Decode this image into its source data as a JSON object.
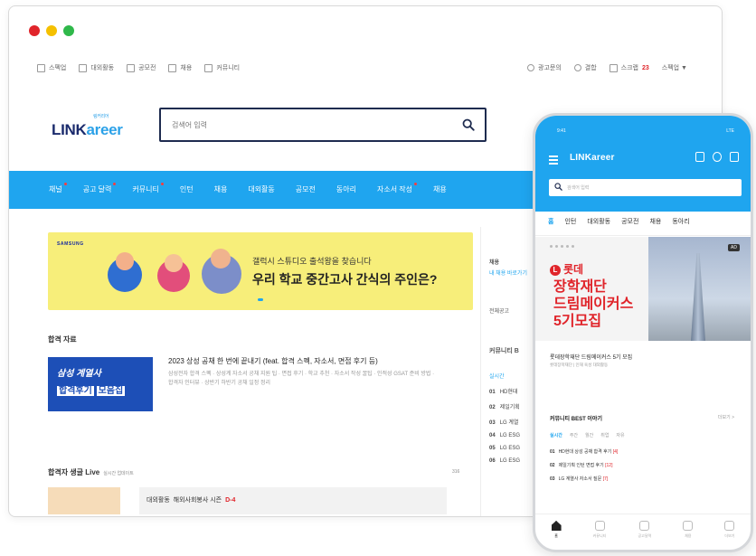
{
  "window": {
    "controls": [
      "#e0242a",
      "#f5c000",
      "#2fb84a"
    ]
  },
  "utilbar": {
    "left": [
      "스펙업",
      "대외활동",
      "공모전",
      "채용",
      "커뮤니티"
    ],
    "right": [
      "광고문의",
      "결합",
      "스크랩"
    ],
    "badge": "23",
    "account": "스펙업 ▼"
  },
  "logo": {
    "part1": "LINK",
    "part2": "areer",
    "tagline": "링커리어"
  },
  "search": {
    "placeholder": "검색어 입력"
  },
  "nav": {
    "items": [
      "채널",
      "공고 달력",
      "커뮤니티",
      "인턴",
      "채용",
      "대외활동",
      "공모전",
      "동아리",
      "자소서 작성",
      "채용"
    ],
    "dots": [
      true,
      true,
      true,
      false,
      false,
      false,
      false,
      false,
      true,
      false
    ]
  },
  "banner": {
    "brand": "SAMSUNG",
    "line1": "갤럭시 스튜디오 출석왕을 찾습니다",
    "line2": "우리 학교 중간고사 간식의 주인은?"
  },
  "main": {
    "section_title": "합격 자료",
    "post": {
      "thumb_line1": "삼성 계열사",
      "thumb_line2a": "합격후기",
      "thumb_line2b": "모음집",
      "title": "2023 상성 공채 한 번에 끝내기 (feat. 합격 스펙, 자소서, 면접 후기 등)",
      "desc": "삼성전자 합격 스펙 · 상성계 자소서 공채 지원 팁 · 면접 후기 · 학교 추천 · 자소서 작성 꿀팁 · 인적성 GSAT 준비 방법 · 합격자 인터뷰 · 상반기 하반기 공채 일정 정리"
    },
    "live": {
      "title": "합격자 생글 Live",
      "sub": "실시간 업데이트",
      "count": "316",
      "card_label": "대외활동",
      "card_text": "해외사회봉사 시즌",
      "card_tag": "D-4"
    }
  },
  "rightcol": {
    "box1_title": "채용",
    "box1_sub": "내 채용 바로가기",
    "box2": "전체공고",
    "box3_title": "커뮤니티 B",
    "tab": "실시간",
    "list": [
      {
        "rank": "01",
        "text": "HD현대"
      },
      {
        "rank": "02",
        "text": "제일기획"
      },
      {
        "rank": "03",
        "text": "LG 계열"
      },
      {
        "rank": "04",
        "text": "LG ESG"
      },
      {
        "rank": "05",
        "text": "LG ESG"
      },
      {
        "rank": "06",
        "text": "LG ESG"
      }
    ]
  },
  "phone": {
    "time": "9:41",
    "signal": "LTE",
    "logo": "LINKareer",
    "search_placeholder": "검색어 입력",
    "tabs": [
      "홈",
      "인턴",
      "대외활동",
      "공모전",
      "채용",
      "동아리"
    ],
    "banner": {
      "brand": "롯데",
      "headline1": "장학재단",
      "headline2": "드림메이커스",
      "headline3": "5기모집",
      "badge": "AD",
      "caption": "롯데장학재단 드림메이커스 5기 모집",
      "caption2": "롯데장학재단 | 인재 육성 대외활동"
    },
    "best_title": "커뮤니티 BEST 이야기",
    "best_more": "더보기 >",
    "chips": [
      "실시간",
      "주간",
      "월간",
      "취업",
      "자유"
    ],
    "list": [
      {
        "rank": "01",
        "text": "HD현대 상성 공채 합격 후기",
        "hot": "[4]"
      },
      {
        "rank": "02",
        "text": "제일기획 인턴 면접 후기",
        "hot": "[12]"
      },
      {
        "rank": "03",
        "text": "LG 계열사 자소서 질문",
        "hot": "[7]"
      }
    ],
    "bottom_nav": [
      "홈",
      "커뮤니티",
      "공고달력",
      "채용",
      "더보기"
    ]
  }
}
